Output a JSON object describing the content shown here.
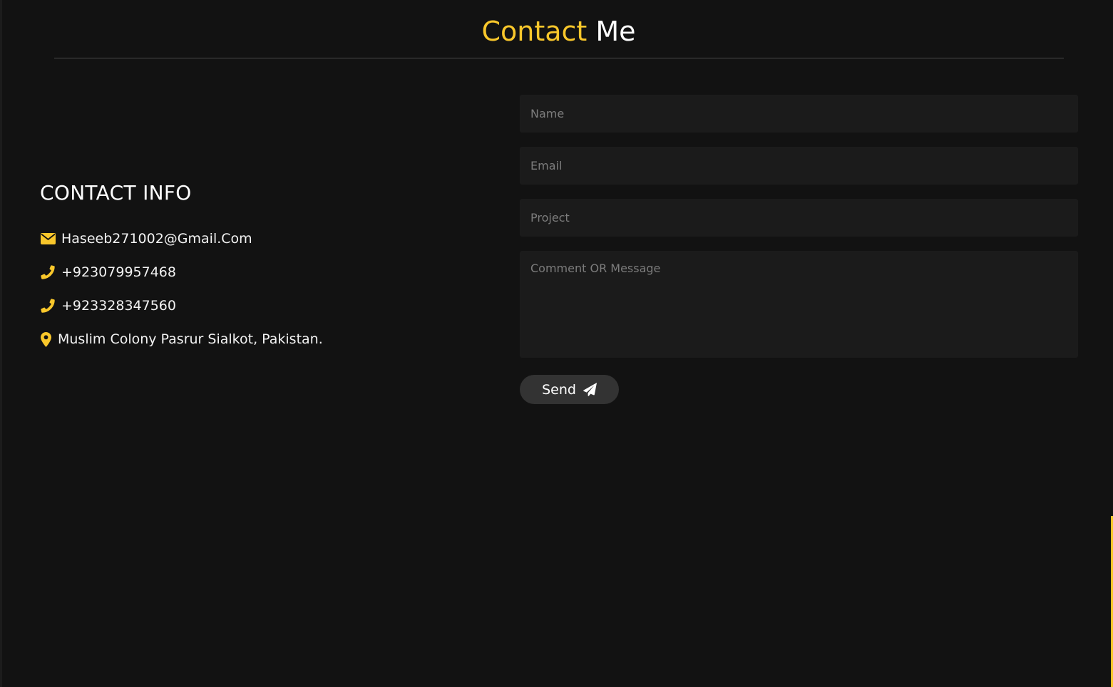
{
  "header": {
    "title_accent": "Contact",
    "title_rest": " Me"
  },
  "contact_info": {
    "heading": "CONTACT INFO",
    "email": "Haseeb271002@Gmail.Com",
    "phone_1": "+923079957468",
    "phone_2": "+923328347560",
    "address": "Muslim Colony Pasrur Sialkot, Pakistan."
  },
  "form": {
    "name_placeholder": "Name",
    "email_placeholder": "Email",
    "project_placeholder": "Project",
    "message_placeholder": "Comment OR Message",
    "send_label": "Send"
  },
  "icons": {
    "email": "envelope-icon",
    "phone": "phone-icon",
    "address": "map-marker-icon",
    "send": "paper-plane-icon"
  },
  "colors": {
    "background": "#121212",
    "accent": "#f9c72b",
    "text": "#ffffff",
    "field_background": "#1b1b1b",
    "button_background": "#333333"
  }
}
